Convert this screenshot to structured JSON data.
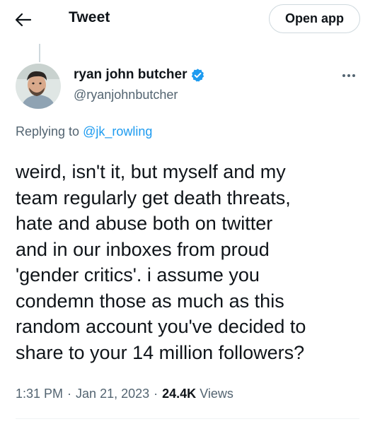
{
  "header": {
    "title": "Tweet",
    "open_app_label": "Open app",
    "back_icon": "arrow-left-icon"
  },
  "author": {
    "display_name": "ryan john butcher",
    "handle": "@ryanjohnbutcher",
    "verified": true,
    "verified_color": "#1d9bf0"
  },
  "reply": {
    "prefix": "Replying to ",
    "mention": "@jk_rowling"
  },
  "tweet": {
    "text": "weird, isn't it, but myself and my\nteam regularly get death threats,\nhate and abuse both on twitter\nand in our inboxes from proud\n'gender critics'. i assume you\ncondemn those as much as this\nrandom account you've decided to\nshare to your 14 million followers?"
  },
  "meta": {
    "time": "1:31 PM",
    "date": "Jan 21, 2023",
    "views_count": "24.4K",
    "views_label": "Views",
    "separator": "·"
  },
  "colors": {
    "accent": "#1d9bf0",
    "secondary_text": "#536471",
    "primary_text": "#0f1419"
  }
}
